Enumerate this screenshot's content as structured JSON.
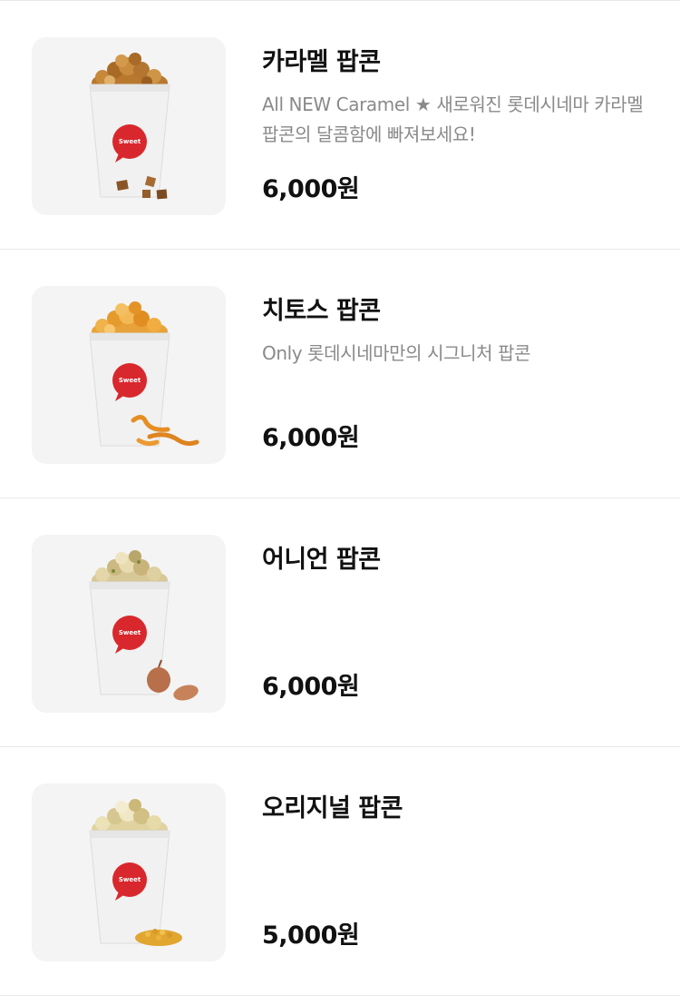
{
  "products": [
    {
      "name": "카라멜 팝콘",
      "description": "All NEW Caramel ★ 새로워진 롯데시네마 카라멜 팝콘의 달콤함에 빠져보세요!",
      "price": "6,000원",
      "image_icon": "caramel-popcorn-image",
      "cup_brand": "Sweet"
    },
    {
      "name": "치토스 팝콘",
      "description": "Only 롯데시네마만의 시그니처 팝콘",
      "price": "6,000원",
      "image_icon": "cheetos-popcorn-image",
      "cup_brand": "Sweet"
    },
    {
      "name": "어니언 팝콘",
      "description": "",
      "price": "6,000원",
      "image_icon": "onion-popcorn-image",
      "cup_brand": "Sweet"
    },
    {
      "name": "오리지널 팝콘",
      "description": "",
      "price": "5,000원",
      "image_icon": "original-popcorn-image",
      "cup_brand": "Sweet"
    }
  ],
  "colors": {
    "thumb_bg": "#f4f4f4",
    "badge_red": "#d8282d",
    "desc_gray": "#8a8a8a",
    "divider": "#e9e9e9"
  }
}
